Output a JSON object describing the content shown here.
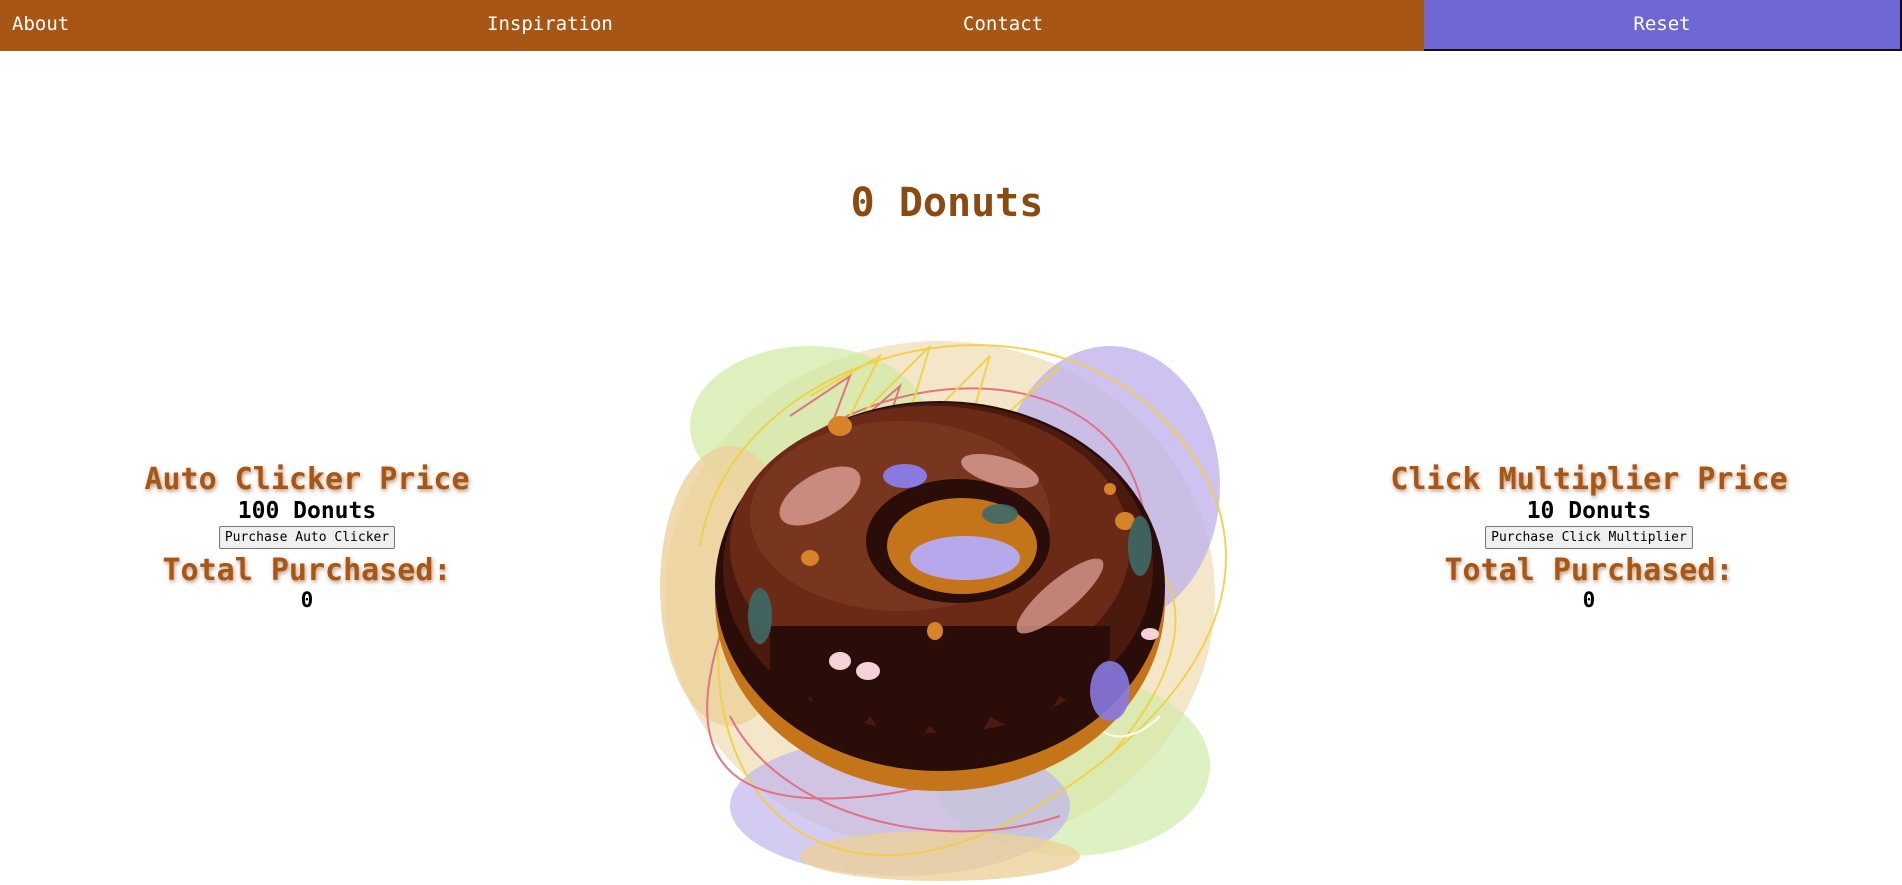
{
  "nav": {
    "about": "About",
    "inspiration": "Inspiration",
    "contact": "Contact",
    "reset": "Reset"
  },
  "game": {
    "donut_count": "0 Donuts"
  },
  "auto_clicker": {
    "title": "Auto Clicker Price",
    "price": "100 Donuts",
    "button": "Purchase Auto Clicker",
    "total_label": "Total Purchased:",
    "total": "0"
  },
  "click_multiplier": {
    "title": "Click Multiplier Price",
    "price": "10 Donuts",
    "button": "Purchase Click Multiplier",
    "total_label": "Total Purchased:",
    "total": "0"
  },
  "colors": {
    "nav_bg": "#a85615",
    "reset_bg": "#6f67d4",
    "title_color": "#a85615",
    "count_color": "#8b4a12"
  },
  "icons": {
    "donut": "chocolate-donut-image"
  }
}
